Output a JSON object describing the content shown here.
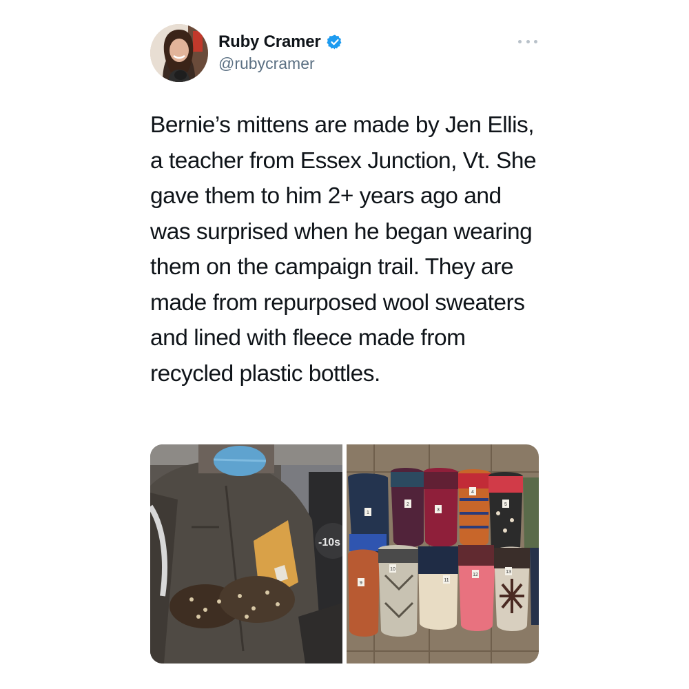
{
  "tweet": {
    "author": {
      "display_name": "Ruby Cramer",
      "handle": "@rubycramer",
      "verified_icon": "verified-badge-icon",
      "avatar_icon": "avatar-photo"
    },
    "more_icon": "more-options-icon",
    "text": "Bernie’s mittens are made by Jen Ellis, a teacher from Essex Junction, Vt. She gave them to him 2+ years ago and was surprised when he began wearing them on the campaign trail. They are made from repurposed wool sweaters and lined with fleece made from recycled plastic bottles.",
    "media": [
      {
        "kind": "photo",
        "subject": "person-in-parka-wearing-mittens",
        "overlay_text": "-10s"
      },
      {
        "kind": "photo",
        "subject": "rows-of-wool-mittens",
        "tag_numbers": [
          "1",
          "2",
          "3",
          "4",
          "5",
          "9",
          "10",
          "11",
          "12",
          "13"
        ]
      }
    ],
    "colors": {
      "verified": "#1d9bf0",
      "handle": "#5b7083",
      "text": "#0f1419"
    }
  }
}
